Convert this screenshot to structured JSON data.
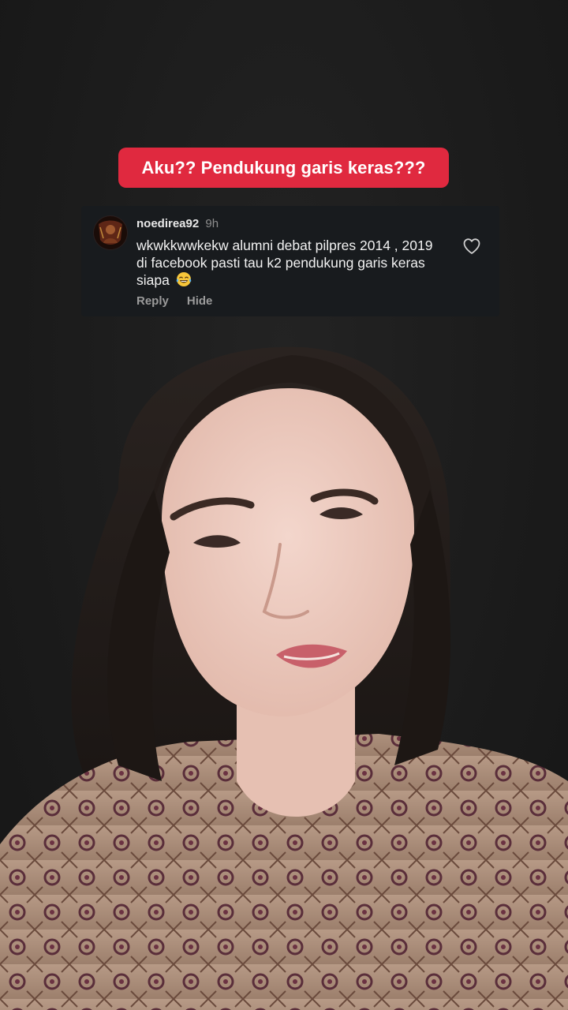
{
  "caption": {
    "text": "Aku?? Pendukung garis keras???",
    "color": "#e0293f"
  },
  "comment": {
    "username": "noedirea92",
    "time": "9h",
    "text": "wkwkkwwkekw alumni debat pilpres 2014 , 2019 di facebook pasti tau k2 pendukung garis keras siapa",
    "emoji": "face-with-tears-of-joy",
    "reply_label": "Reply",
    "hide_label": "Hide",
    "like_icon": "heart-outline-icon",
    "avatar_icon": "user-avatar"
  },
  "video": {
    "subject": "woman-speaking-to-camera",
    "background": "#1c1c1c"
  }
}
